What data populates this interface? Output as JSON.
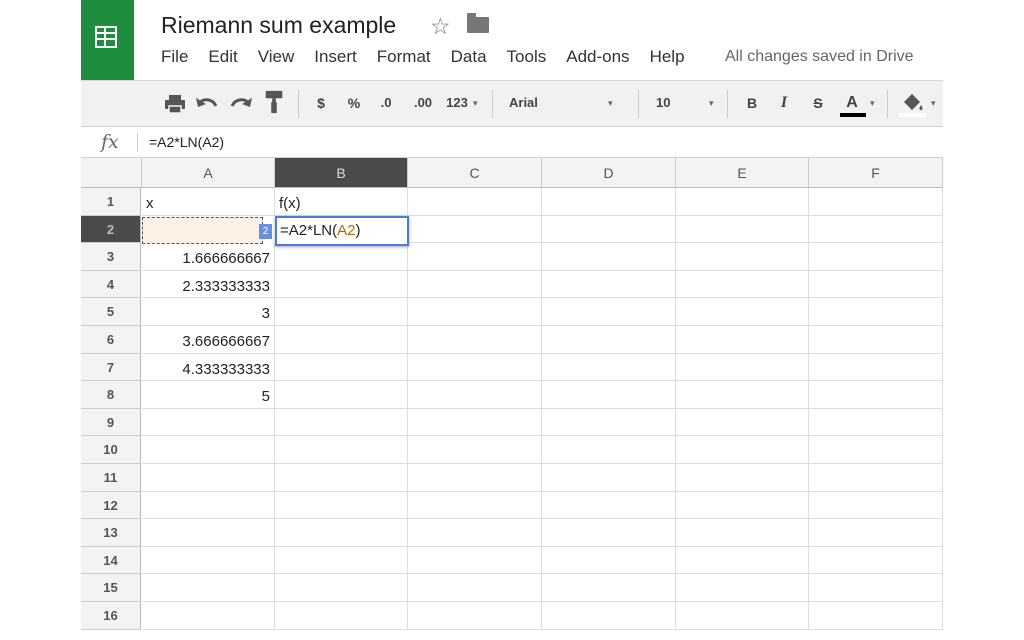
{
  "doc": {
    "title": "Riemann sum example",
    "save_status": "All changes saved in Drive"
  },
  "menu": [
    "File",
    "Edit",
    "View",
    "Insert",
    "Format",
    "Data",
    "Tools",
    "Add-ons",
    "Help"
  ],
  "toolbar": {
    "currency": "$",
    "percent": "%",
    "dec_decrease": ".0",
    "dec_increase": ".00",
    "more_formats": "123",
    "font": "Arial",
    "font_size": "10",
    "bold": "B",
    "italic": "I",
    "strike": "S",
    "text_color": "A"
  },
  "formula_bar": {
    "label": "fx",
    "value": "=A2*LN(A2)"
  },
  "columns": [
    "A",
    "B",
    "C",
    "D",
    "E",
    "F"
  ],
  "rows": [
    "1",
    "2",
    "3",
    "4",
    "5",
    "6",
    "7",
    "8",
    "9",
    "10",
    "11",
    "12",
    "13",
    "14",
    "15",
    "16"
  ],
  "cells": {
    "A1": "x",
    "B1": "f(x)",
    "A3": "1.666666667",
    "A4": "2.333333333",
    "A5": "3",
    "A6": "3.666666667",
    "A7": "4.333333333",
    "A8": "5",
    "B2_edit": "=A2*LN(A2)"
  },
  "selection": {
    "active_cell": "B2",
    "referenced_cell": "A2",
    "chip": "2"
  },
  "colors": {
    "brand": "#1e8e3e",
    "selection": "#4a7be5",
    "reference": "#b36b00"
  }
}
